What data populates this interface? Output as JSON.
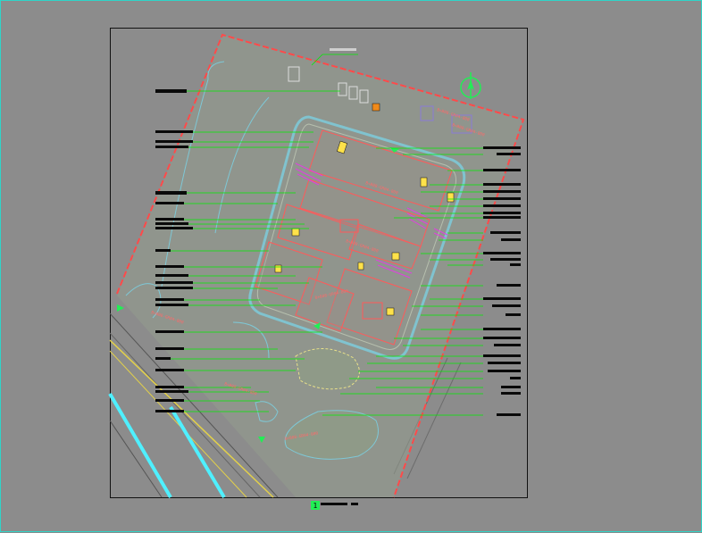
{
  "drawing": {
    "zone_labels": [
      "B+B08-GR04-800",
      "B+B08-GR04-800",
      "B+B08-GR04-800",
      "B+B08-GR04-800",
      "B+B08-GR04-800",
      "B+B08-GR04-800",
      "B+B08-GR04-800",
      "B+B08-GR04-800"
    ],
    "sheet_number": "1",
    "sheet_title": "",
    "colors": {
      "background": "#8c8c8c",
      "sheet_border": "#111111",
      "site_boundary": "#ff4a4a",
      "leader": "#00ee00",
      "road": "#7ec8d6",
      "building": "#ff5a5a",
      "magenta": "#e040e0",
      "yellow": "#ffe24a",
      "cyan": "#4ff0ff",
      "text_label": "#0a0a0a"
    },
    "icons": [
      "north-arrow-icon",
      "sheet-number-icon"
    ]
  }
}
